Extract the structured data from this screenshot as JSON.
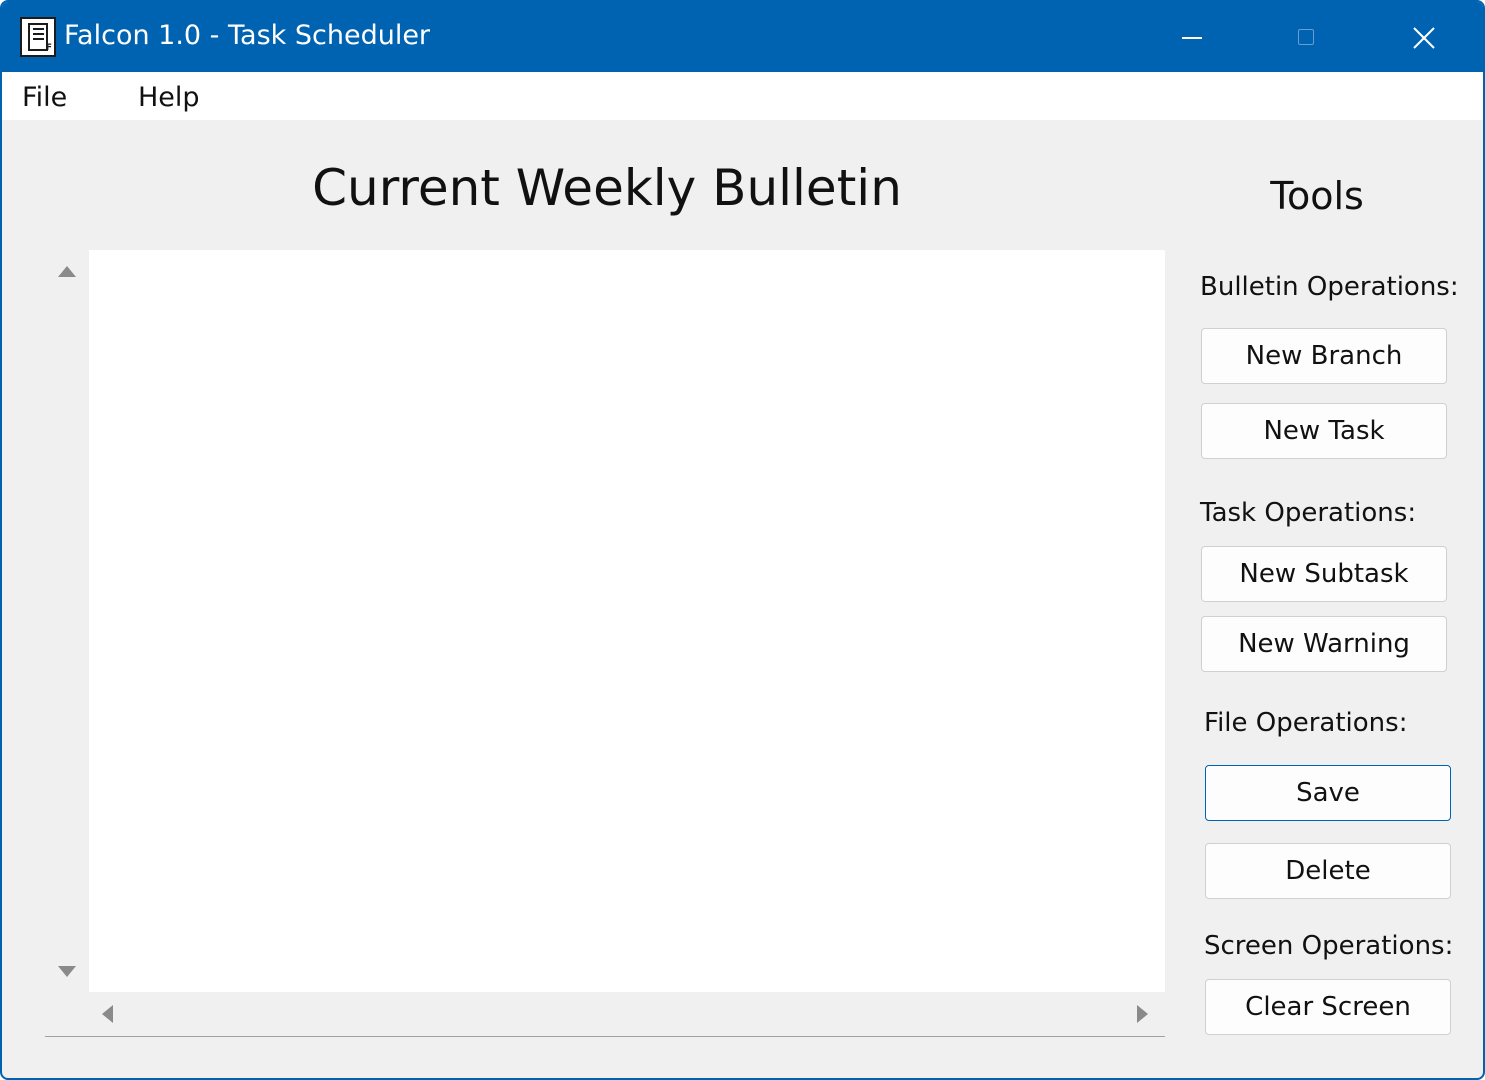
{
  "window": {
    "title": "Falcon 1.0 - Task Scheduler",
    "app_icon_letter": "F",
    "accent_color": "#0063b1"
  },
  "menu": {
    "items": [
      {
        "label": "File"
      },
      {
        "label": "Help"
      }
    ]
  },
  "main": {
    "heading": "Current Weekly Bulletin"
  },
  "tools": {
    "heading": "Tools",
    "sections": [
      {
        "label": "Bulletin Operations:",
        "buttons": [
          "New Branch",
          "New Task"
        ]
      },
      {
        "label": "Task Operations:",
        "buttons": [
          "New Subtask",
          "New Warning"
        ]
      },
      {
        "label": "File Operations:",
        "buttons": [
          "Save",
          "Delete"
        ]
      },
      {
        "label": "Screen Operations:",
        "buttons": [
          "Clear Screen"
        ]
      }
    ]
  }
}
